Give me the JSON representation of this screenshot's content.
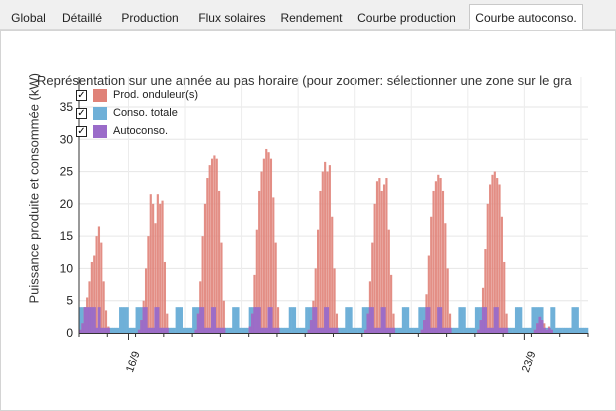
{
  "tabs": [
    {
      "label": "Global"
    },
    {
      "label": "Détaillé"
    },
    {
      "label": "Production"
    },
    {
      "label": "Flux solaires"
    },
    {
      "label": "Rendement"
    },
    {
      "label": "Courbe production"
    },
    {
      "label": "Courbe autoconso."
    }
  ],
  "active_tab": "Courbe autoconso.",
  "colors": {
    "production": "#e08278",
    "consumption": "#6fb0d8",
    "autoconso": "#9a6bc9"
  },
  "legend_check_glyph": "✓",
  "chart_data": {
    "type": "bar",
    "title": "Représentation sur une année au pas horaire (pour zoomer: sélectionner une zone sur le gra",
    "ylabel": "Puissance produite et consommée (kW)",
    "xlabel": "",
    "ylim": [
      0,
      35
    ],
    "yticks": [
      "0",
      "5",
      "10",
      "15",
      "20",
      "25",
      "30",
      "35"
    ],
    "xtick_labels": [
      {
        "label": "16/9",
        "hour": 21
      },
      {
        "label": "23/9",
        "hour": 189
      }
    ],
    "hours_shown": 216,
    "grid": true,
    "legend_position": "top-left",
    "series": [
      {
        "name": "Prod. onduleur(s)",
        "key": "production",
        "checked": true
      },
      {
        "name": "Conso. totale",
        "key": "consumption",
        "checked": true
      },
      {
        "name": "Autoconso.",
        "key": "autoconso",
        "checked": true
      }
    ],
    "production_days": [
      {
        "start_hour": 0,
        "values": [
          0.5,
          1.5,
          4,
          5.5,
          8,
          11,
          12,
          15,
          16.5,
          14,
          8,
          3.5,
          1
        ]
      },
      {
        "start_hour": 25,
        "values": [
          0.5,
          2,
          5,
          10,
          15,
          21.5,
          20,
          17,
          21.5,
          20,
          20.5,
          11,
          3
        ]
      },
      {
        "start_hour": 49,
        "values": [
          0.5,
          3,
          8,
          15,
          20,
          24,
          26,
          27,
          27.5,
          27,
          22,
          14,
          5
        ]
      },
      {
        "start_hour": 72,
        "values": [
          1,
          3,
          9,
          16,
          22,
          25,
          27,
          28.5,
          28,
          27,
          21,
          14,
          4
        ]
      },
      {
        "start_hour": 97,
        "values": [
          0.5,
          2,
          5,
          10,
          16,
          22,
          25,
          26.5,
          25,
          26,
          18,
          10,
          3
        ]
      },
      {
        "start_hour": 121,
        "values": [
          0.5,
          3,
          8,
          14,
          20,
          23.5,
          24,
          22,
          23,
          24,
          16,
          9,
          3
        ]
      },
      {
        "start_hour": 145,
        "values": [
          0.5,
          2,
          6,
          12,
          18,
          22,
          23.5,
          24.5,
          24,
          22,
          17,
          10,
          3
        ]
      },
      {
        "start_hour": 169,
        "values": [
          0.5,
          2,
          7,
          13,
          20,
          23,
          24.5,
          25,
          24,
          23,
          18,
          11,
          3
        ]
      },
      {
        "start_hour": 193,
        "values": [
          0.5,
          1.5,
          2.5,
          2,
          1.5,
          0.5,
          1,
          0.5
        ]
      }
    ],
    "consumption_high_kw": 4,
    "consumption_low_kw": 0.8,
    "consumption_high_periods": [
      [
        0,
        7
      ],
      [
        8,
        9
      ],
      [
        17,
        21
      ],
      [
        24,
        29
      ],
      [
        32,
        34
      ],
      [
        41,
        44
      ],
      [
        48,
        53
      ],
      [
        56,
        58
      ],
      [
        65,
        68
      ],
      [
        72,
        77
      ],
      [
        80,
        82
      ],
      [
        89,
        92
      ],
      [
        96,
        101
      ],
      [
        104,
        106
      ],
      [
        113,
        116
      ],
      [
        120,
        125
      ],
      [
        128,
        130
      ],
      [
        137,
        140
      ],
      [
        144,
        149
      ],
      [
        152,
        154
      ],
      [
        161,
        164
      ],
      [
        168,
        173
      ],
      [
        176,
        178
      ],
      [
        185,
        188
      ],
      [
        192,
        197
      ],
      [
        200,
        202
      ],
      [
        209,
        212
      ]
    ]
  }
}
